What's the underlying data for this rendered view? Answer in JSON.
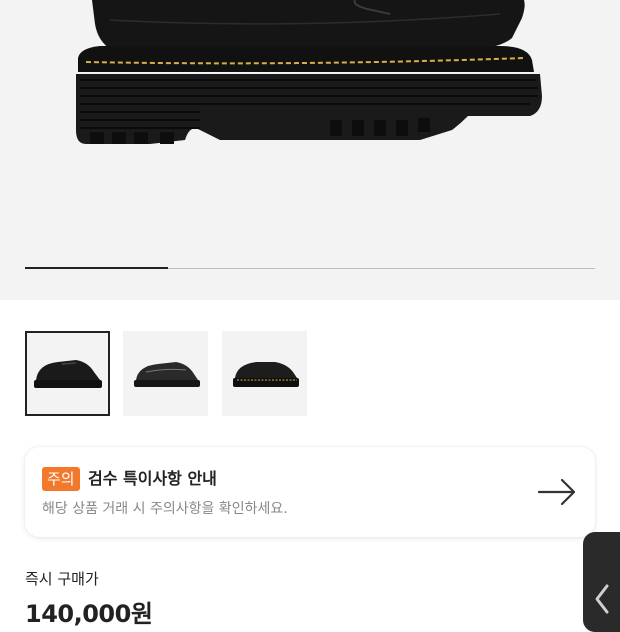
{
  "hero": {
    "image_icon": "black-platform-boot-image",
    "carousel_progress": 0.25
  },
  "thumbnails": [
    {
      "icon": "black-derby-shoe-thumbnail",
      "selected": true
    },
    {
      "icon": "black-derby-shoe-side-thumbnail",
      "selected": false
    },
    {
      "icon": "black-slip-on-shoe-thumbnail",
      "selected": false
    }
  ],
  "notice": {
    "badge": "주의",
    "title": "검수 특이사항 안내",
    "subtitle": "해당 상품 거래 시 주의사항을 확인하세요.",
    "arrow_icon": "arrow-right-icon",
    "badge_color": "#f2792b"
  },
  "purchase": {
    "label": "즉시 구매가",
    "price": "140,000원"
  },
  "side_tab": {
    "icon": "chevron-left-icon"
  }
}
